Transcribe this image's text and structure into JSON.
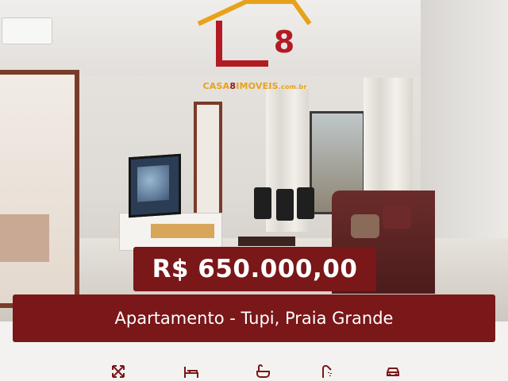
{
  "listing": {
    "price": "R$ 650.000,00",
    "title": "Apartamento - Tupi, Praia Grande"
  },
  "logo": {
    "mark": "L 8",
    "site_prefix": "CASA",
    "site_mid": "8",
    "site_suffix": "IMOVEIS",
    "site_domain": ".com.br"
  },
  "features": [
    {
      "icon": "area-icon"
    },
    {
      "icon": "bed-icon"
    },
    {
      "icon": "bathtub-icon"
    },
    {
      "icon": "shower-icon"
    },
    {
      "icon": "car-icon"
    }
  ],
  "colors": {
    "brand": "#7a1719",
    "logo_orange": "#e8a21a",
    "logo_red": "#b31b24"
  }
}
